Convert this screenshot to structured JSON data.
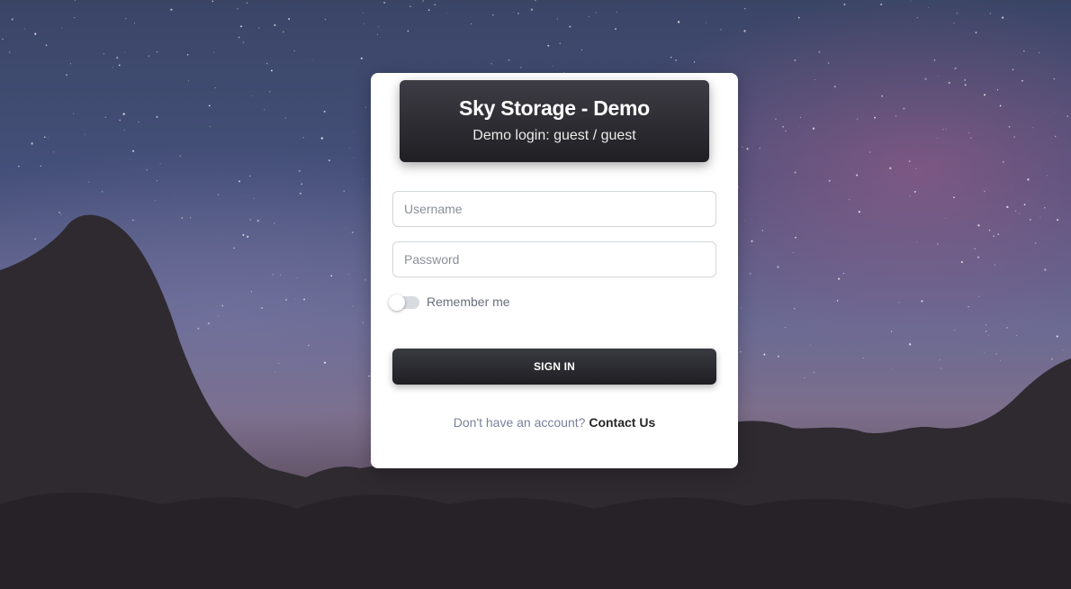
{
  "header": {
    "title": "Sky Storage - Demo",
    "subtitle": "Demo login: guest / guest"
  },
  "form": {
    "username_placeholder": "Username",
    "username_value": "",
    "password_placeholder": "Password",
    "password_value": "",
    "remember_label": "Remember me",
    "remember_checked": false,
    "signin_label": "SIGN IN"
  },
  "footer": {
    "prompt": "Don't have an account?",
    "link_label": "Contact Us"
  },
  "colors": {
    "header_bg": "#232328",
    "button_bg": "#26262b",
    "link": "#262626"
  }
}
